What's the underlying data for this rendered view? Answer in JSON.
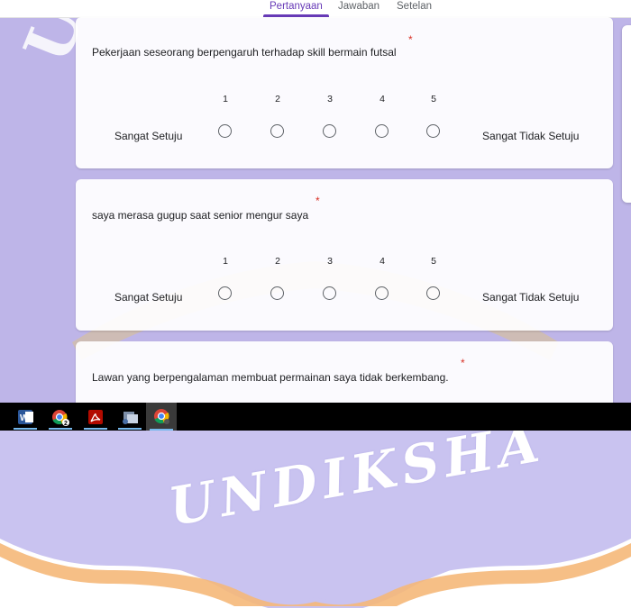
{
  "tabs": [
    {
      "label": "Pertanyaan",
      "active": true
    },
    {
      "label": "Jawaban",
      "active": false
    },
    {
      "label": "Setelan",
      "active": false
    }
  ],
  "questions": [
    {
      "title": "Pekerjaan seseorang berpengaruh terhadap skill bermain futsal",
      "required_mark": "*",
      "scale": [
        "1",
        "2",
        "3",
        "4",
        "5"
      ],
      "low_label": "Sangat Setuju",
      "high_label": "Sangat Tidak Setuju"
    },
    {
      "title": "saya merasa gugup saat senior mengur saya",
      "required_mark": "*",
      "scale": [
        "1",
        "2",
        "3",
        "4",
        "5"
      ],
      "low_label": "Sangat Setuju",
      "high_label": "Sangat Tidak Setuju"
    },
    {
      "title": "Lawan yang berpengalaman membuat permainan saya tidak berkembang.",
      "required_mark": "*"
    }
  ],
  "taskbar": {
    "apps": [
      "word-icon",
      "chrome-icon",
      "acrobat-icon",
      "network-app-icon",
      "chrome-active-icon"
    ],
    "chrome_badge": "2"
  },
  "watermark": {
    "text": "UNDIKSHA",
    "partial_text": "UNI",
    "color_purple": "#b8b0e8",
    "color_gold": "#f5c542",
    "color_orange": "#f0a24a"
  },
  "colors": {
    "accent": "#673ab7",
    "required": "#d93025",
    "taskbar_bg": "#000000"
  }
}
